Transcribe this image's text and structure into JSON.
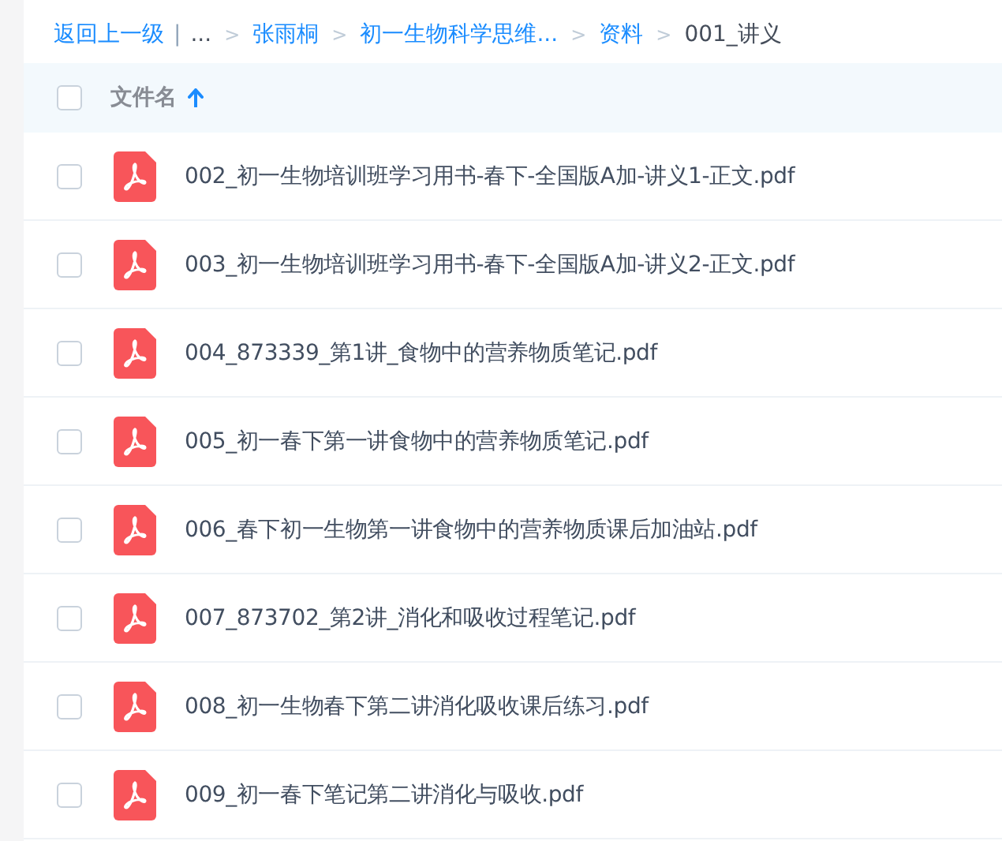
{
  "breadcrumb": [
    {
      "kind": "link",
      "text": "返回上一级"
    },
    {
      "kind": "divider",
      "text": "|"
    },
    {
      "kind": "plain",
      "text": "..."
    },
    {
      "kind": "separator",
      "text": ">"
    },
    {
      "kind": "link",
      "text": "张雨桐"
    },
    {
      "kind": "separator",
      "text": ">"
    },
    {
      "kind": "link",
      "text": "初一生物科学思维..."
    },
    {
      "kind": "separator",
      "text": ">"
    },
    {
      "kind": "link",
      "text": "资料"
    },
    {
      "kind": "separator",
      "text": ">"
    },
    {
      "kind": "plain",
      "text": "001_讲义"
    }
  ],
  "table": {
    "header": {
      "label": "文件名",
      "checked": false
    },
    "rows": [
      {
        "name": "002_初一生物培训班学习用书-春下-全国版A加-讲义1-正文.pdf",
        "checked": false
      },
      {
        "name": "003_初一生物培训班学习用书-春下-全国版A加-讲义2-正文.pdf",
        "checked": false
      },
      {
        "name": "004_873339_第1讲_食物中的营养物质笔记.pdf",
        "checked": false
      },
      {
        "name": "005_初一春下第一讲食物中的营养物质笔记.pdf",
        "checked": false
      },
      {
        "name": "006_春下初一生物第一讲食物中的营养物质课后加油站.pdf",
        "checked": false
      },
      {
        "name": "007_873702_第2讲_消化和吸收过程笔记.pdf",
        "checked": false
      },
      {
        "name": "008_初一生物春下第二讲消化吸收课后练习.pdf",
        "checked": false
      },
      {
        "name": "009_初一春下笔记第二讲消化与吸收.pdf",
        "checked": false
      }
    ]
  }
}
